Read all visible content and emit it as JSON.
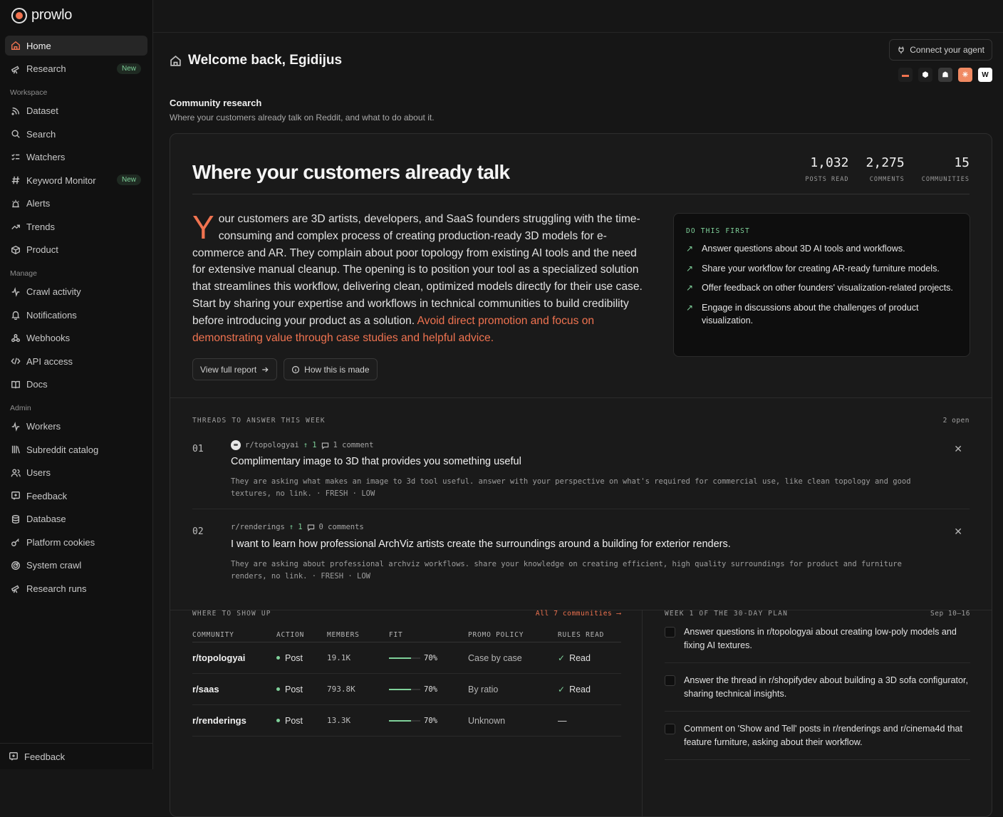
{
  "app": {
    "name": "prowlo"
  },
  "sidebar": {
    "top": [
      {
        "label": "Home",
        "icon": "home-icon",
        "active": true
      },
      {
        "label": "Research",
        "icon": "telescope-icon",
        "badge": "New"
      }
    ],
    "workspace_title": "Workspace",
    "workspace": [
      {
        "label": "Dataset",
        "icon": "rss-icon"
      },
      {
        "label": "Search",
        "icon": "search-icon"
      },
      {
        "label": "Watchers",
        "icon": "list-checks-icon"
      },
      {
        "label": "Keyword Monitor",
        "icon": "hash-icon",
        "badge": "New"
      },
      {
        "label": "Alerts",
        "icon": "siren-icon"
      },
      {
        "label": "Trends",
        "icon": "trending-up-icon"
      },
      {
        "label": "Product",
        "icon": "box-icon"
      }
    ],
    "manage_title": "Manage",
    "manage": [
      {
        "label": "Crawl activity",
        "icon": "activity-icon"
      },
      {
        "label": "Notifications",
        "icon": "bell-icon"
      },
      {
        "label": "Webhooks",
        "icon": "webhook-icon"
      },
      {
        "label": "API access",
        "icon": "code-icon"
      },
      {
        "label": "Docs",
        "icon": "book-icon"
      }
    ],
    "admin_title": "Admin",
    "admin": [
      {
        "label": "Workers",
        "icon": "activity-icon"
      },
      {
        "label": "Subreddit catalog",
        "icon": "library-icon"
      },
      {
        "label": "Users",
        "icon": "users-icon"
      },
      {
        "label": "Feedback",
        "icon": "message-plus-icon"
      },
      {
        "label": "Database",
        "icon": "database-icon"
      },
      {
        "label": "Platform cookies",
        "icon": "key-icon"
      },
      {
        "label": "System crawl",
        "icon": "radar-icon"
      },
      {
        "label": "Research runs",
        "icon": "telescope-icon"
      }
    ],
    "footer_label": "Feedback"
  },
  "header": {
    "welcome": "Welcome back, Egidijus",
    "connect_label": "Connect your agent",
    "agents": [
      {
        "name": "sofa-agent-icon",
        "bg": "#1f1f1f",
        "fg": "#f07350",
        "glyph": "▬"
      },
      {
        "name": "cube-agent-icon",
        "bg": "#1f1f1f",
        "fg": "#ffffff",
        "glyph": "⬢"
      },
      {
        "name": "robot-agent-icon",
        "bg": "#3a3a3a",
        "fg": "#ffffff",
        "glyph": "☗"
      },
      {
        "name": "sparkle-agent-icon",
        "bg": "#f08a63",
        "fg": "#ffffff",
        "glyph": "✳"
      },
      {
        "name": "windsurf-agent-icon",
        "bg": "#ffffff",
        "fg": "#111111",
        "glyph": "W"
      }
    ]
  },
  "section": {
    "title": "Community research",
    "subtitle": "Where your customers already talk on Reddit, and what to do about it."
  },
  "report": {
    "title": "Where your customers already talk",
    "stats": [
      {
        "value": "1,032",
        "label": "POSTS READ"
      },
      {
        "value": "2,275",
        "label": "COMMENTS"
      },
      {
        "value": "15",
        "label": "COMMUNITIES"
      }
    ],
    "summary_dropcap": "Y",
    "summary_text": "our customers are 3D artists, developers, and SaaS founders struggling with the time-consuming and complex process of creating production-ready 3D models for e-commerce and AR. They complain about poor topology from existing AI tools and the need for extensive manual cleanup. The opening is to position your tool as a specialized solution that streamlines this workflow, delivering clean, optimized models directly for their use case. Start by sharing your expertise and workflows in technical communities to build credibility before introducing your product as a solution. ",
    "summary_highlight": "Avoid direct promotion and focus on demonstrating value through case studies and helpful advice.",
    "view_report_label": "View full report",
    "how_made_label": "How this is made",
    "do_first_title": "DO THIS FIRST",
    "do_first": [
      "Answer questions about 3D AI tools and workflows.",
      "Share your workflow for creating AR-ready furniture models.",
      "Offer feedback on other founders' visualization-related projects.",
      "Engage in discussions about the challenges of product visualization."
    ]
  },
  "threads": {
    "title": "THREADS TO ANSWER THIS WEEK",
    "open_count": "2 open",
    "items": [
      {
        "num": "01",
        "subreddit": "r/topologyai",
        "upvotes": "1",
        "comments": "1 comment",
        "title": "Complimentary image to 3D that provides you something useful",
        "desc": "They are asking what makes an image to 3d tool useful. answer with your perspective on what's required for commercial use, like clean topology and good textures, no link. · FRESH · LOW"
      },
      {
        "num": "02",
        "subreddit": "r/renderings",
        "upvotes": "1",
        "comments": "0 comments",
        "title": "I want to learn how professional ArchViz artists create the surroundings around a building for exterior renders.",
        "desc": "They are asking about professional archviz workflows. share your knowledge on creating efficient, high quality surroundings for product and furniture renders, no link. · FRESH · LOW"
      }
    ]
  },
  "communities": {
    "title": "WHERE TO SHOW UP",
    "all_link": "All 7 communities ⟶",
    "headers": [
      "COMMUNITY",
      "ACTION",
      "MEMBERS",
      "FIT",
      "PROMO POLICY",
      "RULES READ"
    ],
    "rows": [
      {
        "community": "r/topologyai",
        "action": "Post",
        "members": "19.1K",
        "fit": "70%",
        "fit_value": 0.7,
        "promo": "Case by case",
        "rules": "Read",
        "rules_read": true
      },
      {
        "community": "r/saas",
        "action": "Post",
        "members": "793.8K",
        "fit": "70%",
        "fit_value": 0.7,
        "promo": "By ratio",
        "rules": "Read",
        "rules_read": true
      },
      {
        "community": "r/renderings",
        "action": "Post",
        "members": "13.3K",
        "fit": "70%",
        "fit_value": 0.7,
        "promo": "Unknown",
        "rules": "—",
        "rules_read": false
      }
    ]
  },
  "plan": {
    "title": "WEEK 1 OF THE 30-DAY PLAN",
    "dates": "Sep 10–16",
    "items": [
      "Answer questions in r/topologyai about creating low-poly models and fixing AI textures.",
      "Answer the thread in r/shopifydev about building a 3D sofa configurator, sharing technical insights.",
      "Comment on 'Show and Tell' posts in r/renderings and r/cinema4d that feature furniture, asking about their workflow."
    ]
  },
  "colors": {
    "accent": "#f07350",
    "positive": "#7fd19a",
    "background": "#161616",
    "sidebar": "#111111"
  }
}
